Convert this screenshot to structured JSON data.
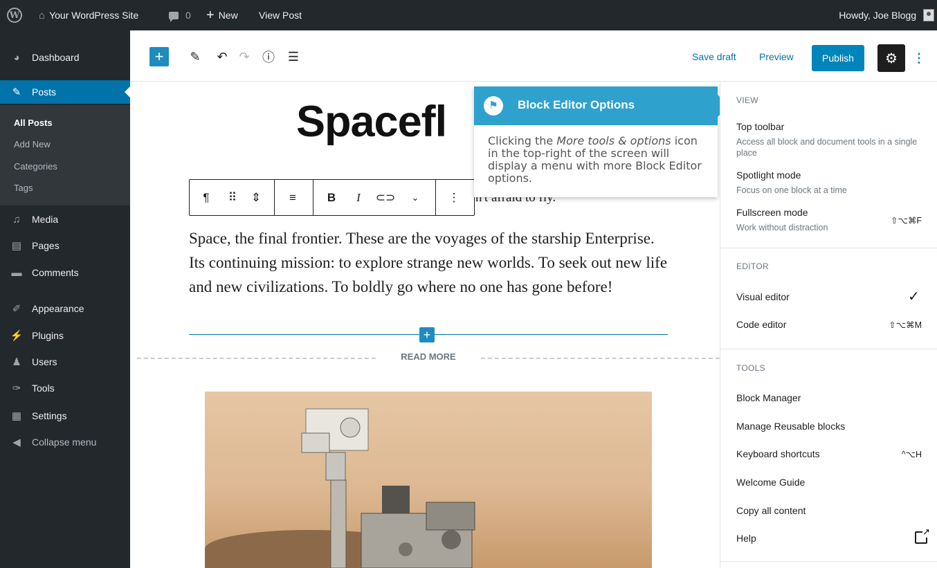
{
  "admin_bar": {
    "wp_logo": "W",
    "site_name": "Your WordPress Site",
    "comment_count": "0",
    "new_label": "New",
    "view_post_label": "View Post",
    "howdy": "Howdy, Joe Blogg"
  },
  "sidebar": {
    "menu": [
      {
        "label": "Dashboard",
        "icon": "dashboard-icon"
      },
      {
        "label": "Posts",
        "icon": "pin-icon",
        "current": true
      },
      {
        "label": "Media",
        "icon": "media-icon"
      },
      {
        "label": "Pages",
        "icon": "pages-icon"
      },
      {
        "label": "Comments",
        "icon": "comment-icon"
      },
      {
        "label": "Appearance",
        "icon": "brush-icon"
      },
      {
        "label": "Plugins",
        "icon": "plugin-icon"
      },
      {
        "label": "Users",
        "icon": "users-icon"
      },
      {
        "label": "Tools",
        "icon": "wrench-icon"
      },
      {
        "label": "Settings",
        "icon": "settings-icon"
      },
      {
        "label": "Collapse menu",
        "icon": "collapse-icon"
      }
    ],
    "submenu": [
      "All Posts",
      "Add New",
      "Categories",
      "Tags"
    ]
  },
  "header": {
    "save_draft": "Save draft",
    "preview": "Preview",
    "publish": "Publish"
  },
  "content": {
    "title": "Spacefl",
    "subline": "n't afraid to fly.",
    "paragraph": "Space, the final frontier. These are the voyages of the starship Enterprise. Its continuing mission: to explore strange new worlds. To seek out new life and new civilizations. To boldly go where no one has gone before!",
    "read_more": "READ MORE"
  },
  "tooltip": {
    "title": "Block Editor Options",
    "body_pre": "Clicking the ",
    "body_em": "More tools & options",
    "body_post": " icon in the top-right of the screen will display a menu with more Block Editor options."
  },
  "options_panel": {
    "view": {
      "heading": "VIEW",
      "items": [
        {
          "label": "Top toolbar",
          "desc": "Access all block and document tools in a single place"
        },
        {
          "label": "Spotlight mode",
          "desc": "Focus on one block at a time"
        },
        {
          "label": "Fullscreen mode",
          "desc": "Work without distraction",
          "shortcut": "⇧⌥⌘F"
        }
      ]
    },
    "editor": {
      "heading": "EDITOR",
      "items": [
        {
          "label": "Visual editor",
          "checked": "✓"
        },
        {
          "label": "Code editor",
          "shortcut": "⇧⌥⌘M"
        }
      ]
    },
    "tools": {
      "heading": "TOOLS",
      "items": [
        {
          "label": "Block Manager"
        },
        {
          "label": "Manage Reusable blocks"
        },
        {
          "label": "Keyboard shortcuts",
          "shortcut": "^⌥H"
        },
        {
          "label": "Welcome Guide"
        },
        {
          "label": "Copy all content"
        },
        {
          "label": "Help"
        }
      ]
    }
  },
  "colors": {
    "admin_dark": "#23282d",
    "accent_blue": "#0073aa",
    "publish_blue": "#0085ba",
    "tip_blue": "#2ea2cc"
  }
}
